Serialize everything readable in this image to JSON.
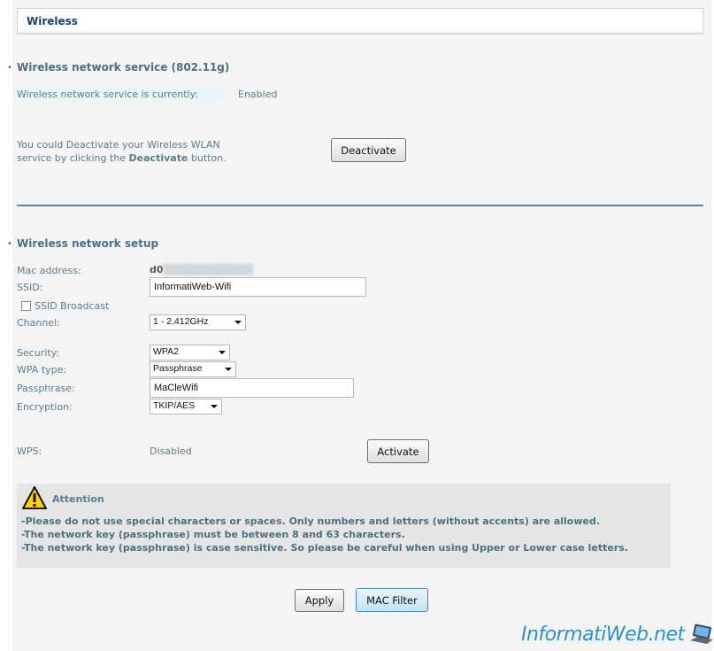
{
  "header": {
    "title": "Wireless"
  },
  "service": {
    "heading": "Wireless network service (802.11g)",
    "status_label": "Wireless network service is currently:",
    "status_value": "Enabled",
    "desc_line1": "You could Deactivate your Wireless WLAN",
    "desc_line2_pre": "service by clicking the ",
    "desc_line2_bold": "Deactivate",
    "desc_line2_post": " button.",
    "deactivate_label": "Deactivate"
  },
  "setup": {
    "heading": "Wireless network setup",
    "mac_label": "Mac address:",
    "mac_value_visible": "d0",
    "ssid_label": "SSID:",
    "ssid_value": "InformatiWeb-Wifi",
    "ssid_broadcast_label": "SSID Broadcast",
    "ssid_broadcast_checked": false,
    "channel_label": "Channel:",
    "channel_value": "1 - 2.412GHz",
    "security_label": "Security:",
    "security_value": "WPA2",
    "wpa_type_label": "WPA type:",
    "wpa_type_value": "Passphrase",
    "passphrase_label": "Passphrase:",
    "passphrase_value": "MaCleWifi",
    "encryption_label": "Encryption:",
    "encryption_value": "TKIP/AES",
    "wps_label": "WPS:",
    "wps_value": "Disabled",
    "activate_label": "Activate"
  },
  "attention": {
    "title": "Attention",
    "lines": [
      "-Please do not use special characters or spaces. Only numbers and letters (without accents) are allowed.",
      "-The network key (passphrase) must be between 8 and 63 characters.",
      "-The network key (passphrase) is case sensitive. So please be careful when using Upper or Lower case letters."
    ]
  },
  "actions": {
    "apply_label": "Apply",
    "mac_filter_label": "MAC Filter"
  },
  "watermark": {
    "text": "InformatiWeb.net"
  },
  "colors": {
    "accent_text": "#4e6f82",
    "title_text": "#1c3f6e",
    "divider": "#5e87a6",
    "watermark": "#2e8fd0"
  }
}
